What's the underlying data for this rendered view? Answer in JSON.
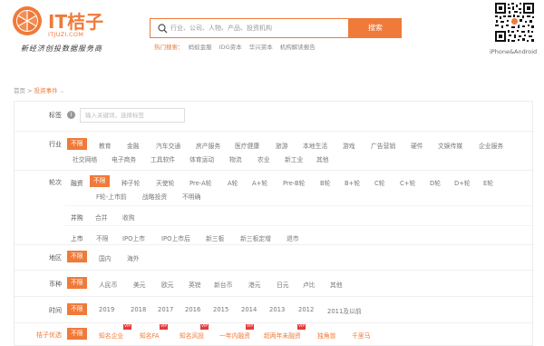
{
  "header": {
    "logo_title": "IT桔子",
    "logo_url": "ITJUZI.COM",
    "logo_slogan": "新经济创投数据服务商",
    "search_placeholder": "行业、公司、人物、产品、投资机构",
    "search_button": "搜索",
    "hot_label": "热门搜索：",
    "hot_items": [
      "蚂蚁金服",
      "IDG资本",
      "华兴资本",
      "机构解读报告"
    ],
    "qr_caption": "iPhone&Android"
  },
  "breadcrumb": {
    "home": "首页",
    "sep": ">",
    "current": "投资事件",
    "arrow": "⌄"
  },
  "filters": {
    "tag": {
      "label": "标签",
      "info": "i",
      "placeholder": "输入关键词，选择标签"
    },
    "industry": {
      "label": "行业",
      "selected": "不限",
      "options_line1": [
        "教育",
        "金融",
        "汽车交通",
        "房产服务",
        "医疗健康",
        "旅游",
        "本地生活",
        "游戏",
        "广告营销",
        "硬件",
        "文娱传媒",
        "企业服务"
      ],
      "options_line2": [
        "社交网络",
        "电子商务",
        "工具软件",
        "体育运动",
        "物流",
        "农业",
        "新工业",
        "其他"
      ]
    },
    "round": {
      "label": "轮次",
      "financing": {
        "label": "融资",
        "selected": "不限",
        "options_line1": [
          "种子轮",
          "天使轮",
          "Pre-A轮",
          "A轮",
          "A+轮",
          "Pre-B轮",
          "B轮",
          "B+轮",
          "C轮",
          "C+轮",
          "D轮",
          "D+轮",
          "E轮"
        ],
        "options_line2": [
          "F轮-上市前",
          "战略投资",
          "不明确"
        ]
      },
      "merger": {
        "label": "并购",
        "options": [
          "合并",
          "收购"
        ]
      },
      "listing": {
        "label": "上市",
        "options": [
          "不限",
          "IPO上市",
          "IPO上市后",
          "新三板",
          "新三板定增",
          "退市"
        ]
      }
    },
    "region": {
      "label": "地区",
      "selected": "不限",
      "options": [
        "国内",
        "海外"
      ]
    },
    "currency": {
      "label": "币种",
      "selected": "不限",
      "options": [
        "人民币",
        "美元",
        "欧元",
        "英镑",
        "新台币",
        "港元",
        "日元",
        "卢比",
        "其他"
      ]
    },
    "time": {
      "label": "时间",
      "selected": "不限",
      "options": [
        "2019",
        "2018",
        "2017",
        "2016",
        "2015",
        "2014",
        "2013",
        "2012",
        "2011及以前"
      ]
    },
    "juzi": {
      "label": "桔子优选",
      "selected": "不限",
      "options": [
        "知名企业",
        "知名FA",
        "知名风投",
        "一年内融资",
        "超两年未融资",
        "独角兽",
        "千里马"
      ],
      "vip_badge": "VIP"
    }
  },
  "colors": {
    "accent": "#f07a3a",
    "vip": "#e43a3a"
  }
}
